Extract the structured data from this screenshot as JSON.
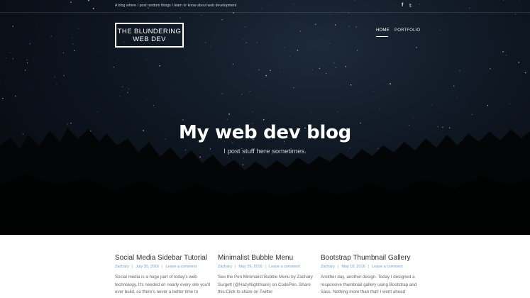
{
  "site": {
    "tagline": "A blog where I post random things I learn or know about web development",
    "logo_line1": "THE BLUNDERING",
    "logo_line2": "WEB DEV",
    "social": {
      "facebook": "f",
      "twitter": "𝕥"
    }
  },
  "nav": {
    "home": "HOME",
    "portfolio": "PORTFOLIO"
  },
  "hero": {
    "title": "My web dev blog",
    "subtitle": "I post stuff here sometimes."
  },
  "posts": [
    {
      "title": "Social Media Sidebar Tutorial",
      "author": "Zachary",
      "date": "July 30, 2016",
      "comment": "Leave a comment",
      "excerpt": "Social media is a huge part of today's web technology. It's needed on nearly every site you'll ever build, so there's never a better time to"
    },
    {
      "title": "Minimalist Bubble Menu",
      "author": "Zachary",
      "date": "May 29, 2016",
      "comment": "Leave a comment",
      "excerpt": "See the Pen Minimalist Bubble Menu by Zachary Surgett (@HazyNightmare) on CodePen. Share this:Click to share on Twitter"
    },
    {
      "title": "Bootstrap Thumbnail Gallery",
      "author": "Zachary",
      "date": "May 18, 2016",
      "comment": "Leave a comment",
      "excerpt": "Another day, another design. Today I designed a responsive thumbnail gallery using Bootstrap and Sass. Nothing more than that! I went ahead"
    }
  ],
  "colors": {
    "accent": "#6fa3d6",
    "heading": "#333333",
    "text": "#666666"
  }
}
